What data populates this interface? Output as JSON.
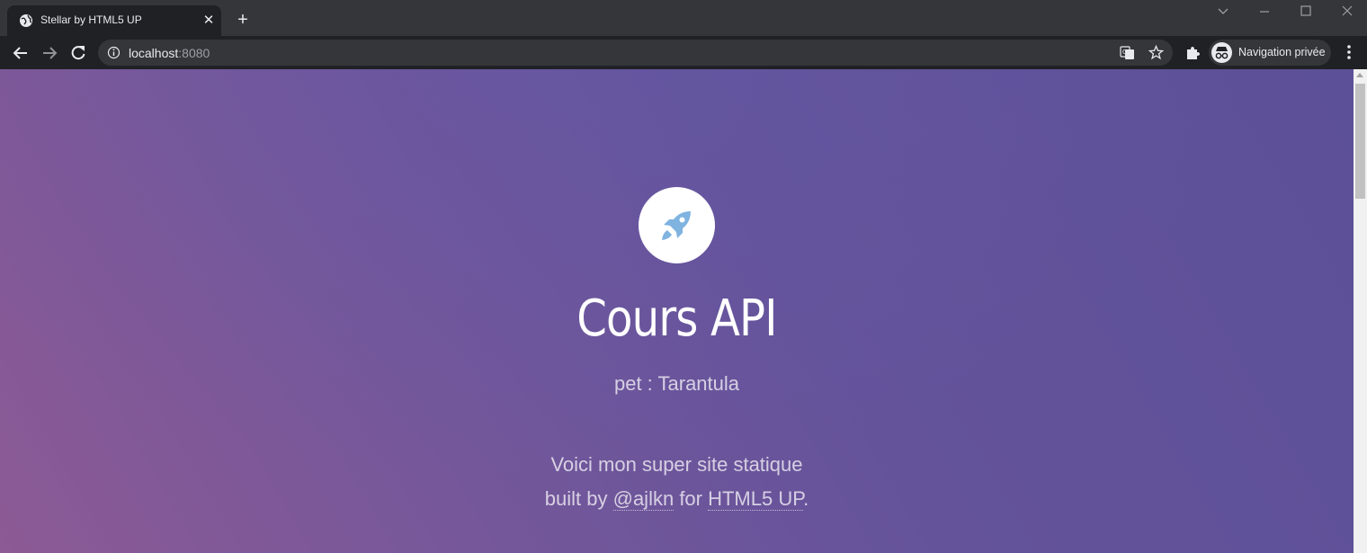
{
  "browser": {
    "tab": {
      "title": "Stellar by HTML5 UP",
      "favicon": "globe-icon"
    },
    "omnibox": {
      "host": "localhost",
      "port": ":8080"
    },
    "incognito_label": "Navigation privée"
  },
  "page": {
    "logo_icon": "rocket-icon",
    "title": "Cours API",
    "subtitle": "pet : Tarantula",
    "description_line1": "Voici mon super site statique",
    "built_by_prefix": "built by ",
    "author_link": "@ajlkn",
    "for_text": " for ",
    "html5up_link": "HTML5 UP",
    "period": "."
  },
  "colors": {
    "gradient_start": "#8c5a95",
    "gradient_end": "#5c5098",
    "logo_icon_color": "#7fb3e0"
  }
}
